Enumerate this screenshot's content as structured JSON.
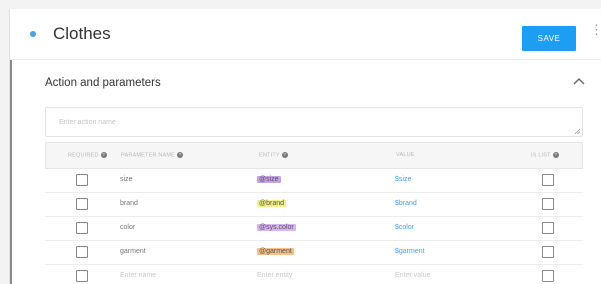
{
  "header": {
    "title": "Clothes",
    "save_label": "SAVE",
    "more_icon": "more-vert-icon"
  },
  "section": {
    "title": "Action and parameters",
    "collapse_icon": "chevron-up-icon"
  },
  "action_input": {
    "placeholder": "Enter action name"
  },
  "table": {
    "headers": {
      "required": "REQUIRED",
      "name": "PARAMETER NAME",
      "entity": "ENTITY",
      "value": "VALUE",
      "list": "IS LIST"
    },
    "rows": [
      {
        "name": "size",
        "entity": "@size",
        "entity_color": "#c8a2e8",
        "value": "$size"
      },
      {
        "name": "brand",
        "entity": "@brand",
        "entity_color": "#f3ef8a",
        "value": "$brand"
      },
      {
        "name": "color",
        "entity": "@sys.color",
        "entity_color": "#d8b4f0",
        "value": "$color"
      },
      {
        "name": "garment",
        "entity": "@garment",
        "entity_color": "#f5c08a",
        "value": "$garment"
      }
    ],
    "new_row": {
      "name_placeholder": "Enter name",
      "entity_placeholder": "Enter entity",
      "value_placeholder": "Enter value"
    }
  },
  "colors": {
    "accent": "#1e9ef2",
    "value_text": "#4aa0e6"
  }
}
